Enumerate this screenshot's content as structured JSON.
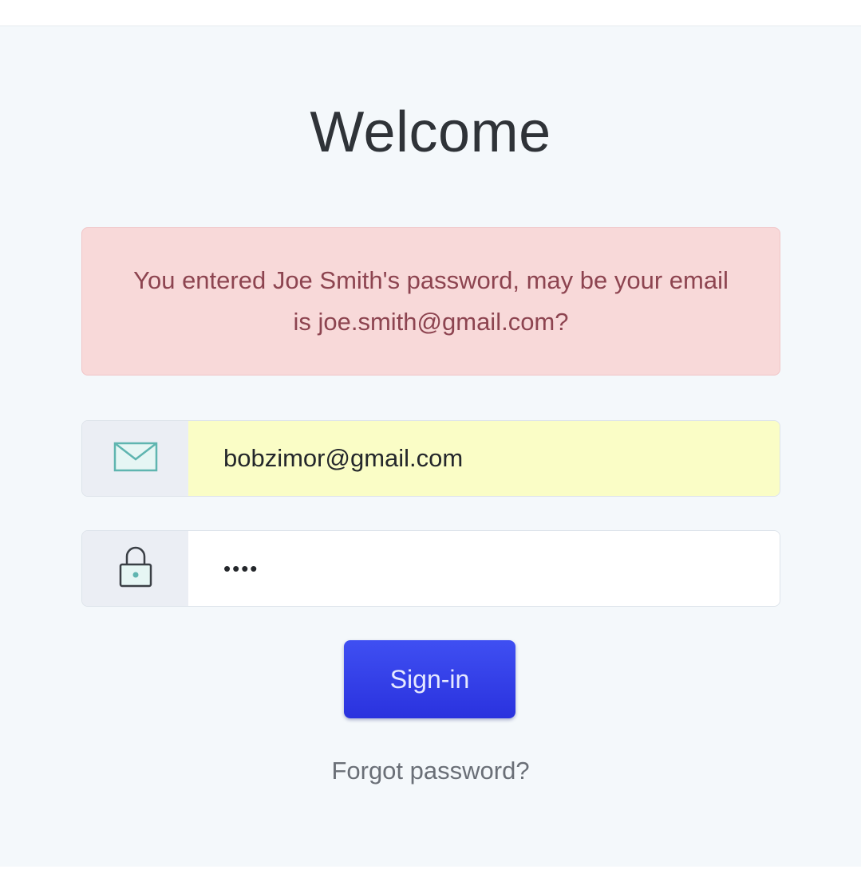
{
  "title": "Welcome",
  "alert": {
    "message": "You entered Joe Smith's password, may be your email is joe.smith@gmail.com?"
  },
  "email_field": {
    "icon": "envelope-icon",
    "value": "bobzimor@gmail.com"
  },
  "password_field": {
    "icon": "lock-icon",
    "value": "••••"
  },
  "signin_button": {
    "label": "Sign-in"
  },
  "forgot_link": {
    "label": "Forgot password?"
  },
  "colors": {
    "background": "#f4f8fb",
    "alert_background": "#f8d9d9",
    "alert_text": "#8d4450",
    "autofill_background": "#fafdc6",
    "button": "#3039e6",
    "icon_teal": "#5fb5b0"
  }
}
